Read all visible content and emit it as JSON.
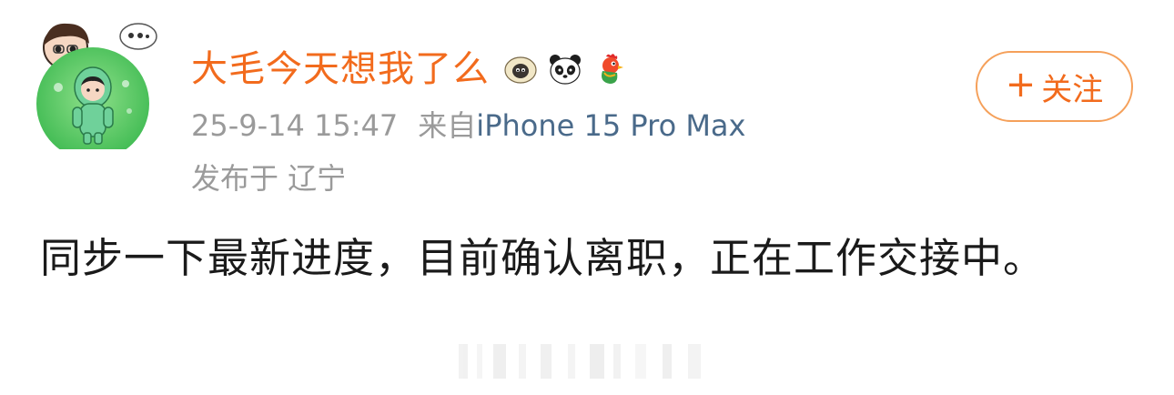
{
  "user": {
    "name": "大毛今天想我了么",
    "badges": [
      "sheep-badge-icon",
      "panda-badge-icon",
      "rooster-badge-icon"
    ]
  },
  "meta": {
    "datetime": "25-9-14 15:47",
    "source_prefix": "来自",
    "device": "iPhone 15 Pro Max",
    "location": "发布于 辽宁"
  },
  "follow": {
    "plus": "+",
    "label": "关注"
  },
  "post": {
    "text": "同步一下最新进度，目前确认离职，正在工作交接中。"
  },
  "colors": {
    "username": "#f26b1d",
    "follow_border": "#f5a05a",
    "meta_gray": "#9a9a9a",
    "text": "#1a1a1a",
    "device_link": "#4a6a8a"
  }
}
